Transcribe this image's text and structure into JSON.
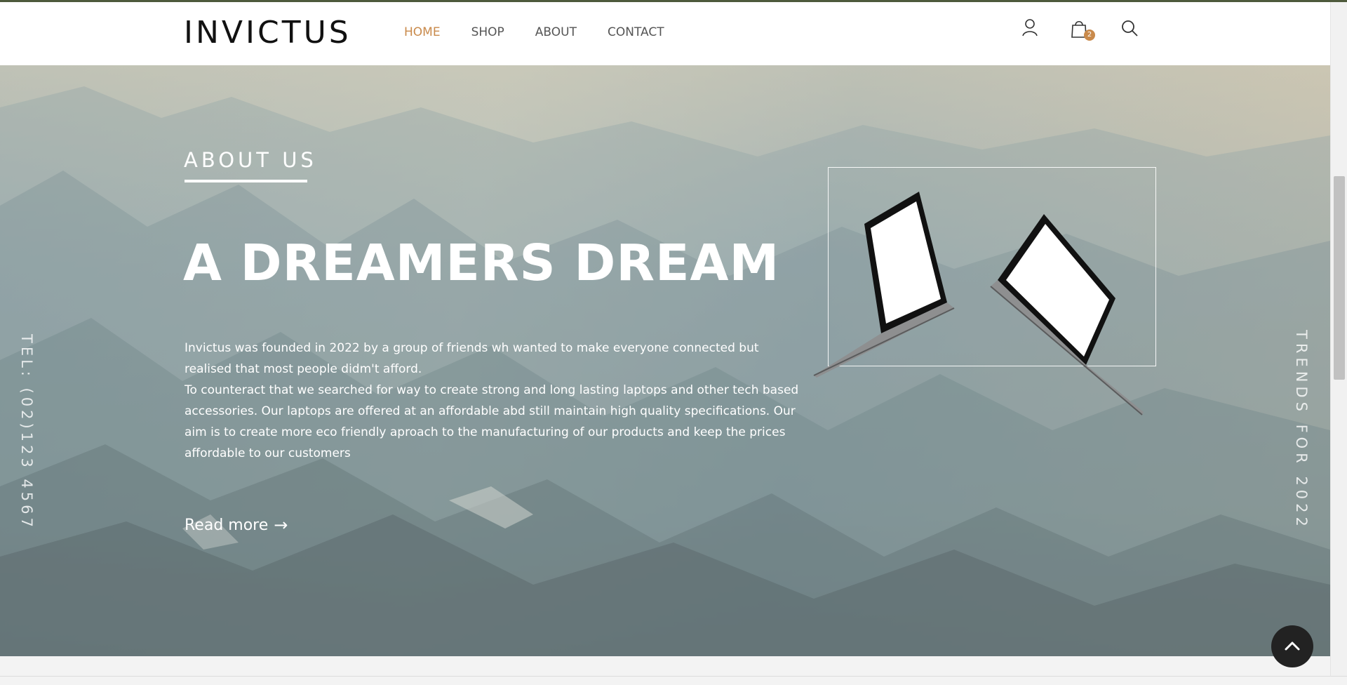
{
  "header": {
    "logo": "INVICTUS",
    "nav": [
      {
        "label": "HOME",
        "active": true
      },
      {
        "label": "SHOP",
        "active": false
      },
      {
        "label": "ABOUT",
        "active": false
      },
      {
        "label": "CONTACT",
        "active": false
      }
    ],
    "cart_count": "2",
    "icons": [
      "user-icon",
      "shopping-bag-icon",
      "search-icon"
    ]
  },
  "hero": {
    "section_label": "ABOUT US",
    "title": "A DREAMERS DREAM",
    "paragraph_1": "Invictus was founded in 2022 by a group of friends wh wanted to make everyone connected but realised that most people didm't afford.",
    "paragraph_2": "To counteract that we searched for way to create strong and long lasting laptops and other tech based accessories. Our laptops are offered at an affordable abd still maintain high quality specifications. Our aim is to create more eco friendly aproach to the manufacturing of our products and keep the prices affordable to our customers",
    "read_more": "Read more",
    "side_left": "TEL: (02)123 4567",
    "side_right": "TRENDS FOR 2022"
  },
  "colors": {
    "accent": "#c98a4b",
    "header_bg": "#ffffff",
    "scroll_top_bg": "#222222"
  }
}
